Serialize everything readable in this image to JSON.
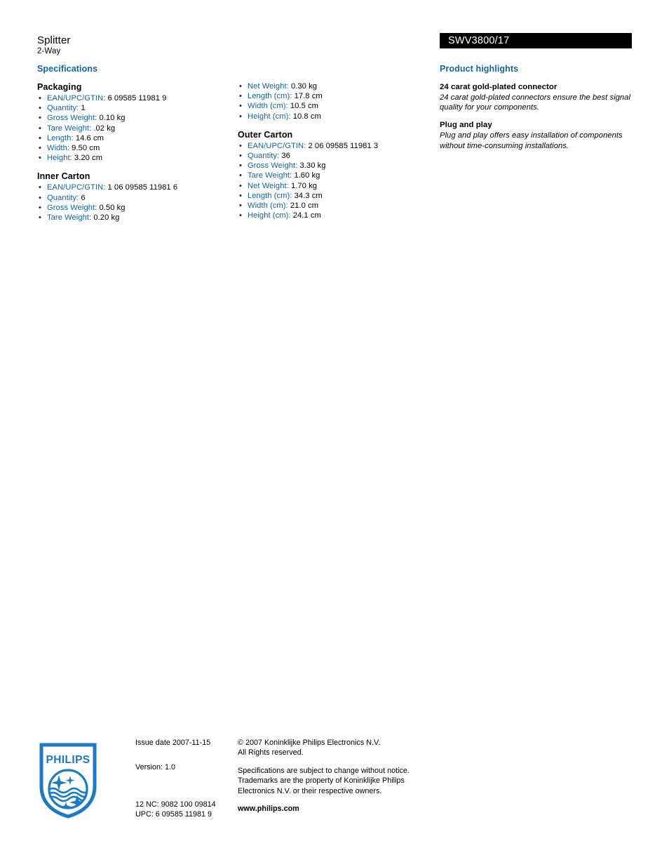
{
  "header": {
    "product_name": "Splitter",
    "product_subname": "2-Way",
    "product_code": "SWV3800/17"
  },
  "colors": {
    "accent_blue": "#1264a3",
    "code_bar_bg": "#000000",
    "code_bar_text": "#ffffff",
    "value_text": "#000000"
  },
  "specifications": {
    "heading": "Specifications",
    "left_column": [
      {
        "title": "Packaging",
        "items": [
          {
            "label": "EAN/UPC/GTIN:",
            "value": "6 09585 11981 9"
          },
          {
            "label": "Quantity:",
            "value": "1"
          },
          {
            "label": "Gross Weight:",
            "value": "0.10 kg"
          },
          {
            "label": "Tare Weight:",
            "value": ".02 kg"
          },
          {
            "label": "Length:",
            "value": "14.6 cm"
          },
          {
            "label": "Width:",
            "value": "9.50 cm"
          },
          {
            "label": "Height:",
            "value": "3.20 cm"
          }
        ]
      },
      {
        "title": "Inner Carton",
        "items": [
          {
            "label": "EAN/UPC/GTIN:",
            "value": "1 06 09585 11981 6"
          },
          {
            "label": "Quantity:",
            "value": "6"
          },
          {
            "label": "Gross Weight:",
            "value": "0.50 kg"
          },
          {
            "label": "Tare Weight:",
            "value": "0.20 kg"
          }
        ]
      }
    ],
    "middle_column": [
      {
        "title": "",
        "items": [
          {
            "label": "Net Weight:",
            "value": "0.30 kg"
          },
          {
            "label": "Length (cm):",
            "value": "17.8 cm"
          },
          {
            "label": "Width (cm):",
            "value": "10.5 cm"
          },
          {
            "label": "Height (cm):",
            "value": "10.8 cm"
          }
        ]
      },
      {
        "title": "Outer Carton",
        "items": [
          {
            "label": "EAN/UPC/GTIN:",
            "value": "2 06 09585 11981 3"
          },
          {
            "label": "Quantity:",
            "value": "36"
          },
          {
            "label": "Gross Weight:",
            "value": "3.30 kg"
          },
          {
            "label": "Tare Weight:",
            "value": "1.60 kg"
          },
          {
            "label": "Net Weight:",
            "value": "1.70 kg"
          },
          {
            "label": "Length (cm):",
            "value": "34.3 cm"
          },
          {
            "label": "Width (cm):",
            "value": "21.0 cm"
          },
          {
            "label": "Height (cm):",
            "value": "24.1 cm"
          }
        ]
      }
    ]
  },
  "product_highlights": {
    "heading": "Product highlights",
    "blocks": [
      {
        "title": "24 carat gold-plated connector",
        "description": "24 carat gold-plated connectors ensure the best signal quality for your components."
      },
      {
        "title": "Plug and play",
        "description": "Plug and play offers easy installation of components without time-consuming installations."
      }
    ]
  },
  "footer": {
    "logo_wordmark": "PHILIPS",
    "issue_date": "Issue date 2007-11-15",
    "version": "Version: 1.0",
    "nc_code": "12 NC: 9082 100 09814",
    "upc_code": "UPC: 6 09585 11981 9",
    "copyright_line1": "© 2007 Koninklijke Philips Electronics N.V.",
    "copyright_line2": "All Rights reserved.",
    "disclaimer_line1": "Specifications are subject to change without notice.",
    "disclaimer_line2": "Trademarks are the property of Koninklijke Philips",
    "disclaimer_line3": "Electronics N.V. or their respective owners.",
    "website": "www.philips.com"
  }
}
